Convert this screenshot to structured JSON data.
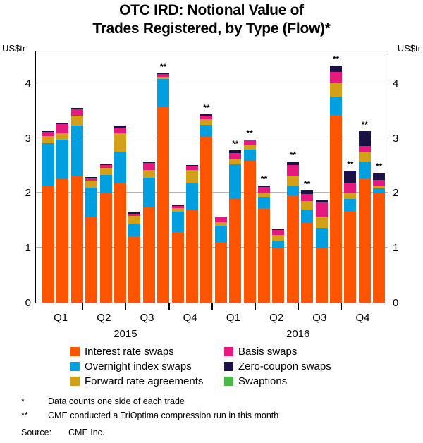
{
  "title_line1": "OTC IRD: Notional Value of",
  "title_line2": "Trades Registered, by Type (Flow)*",
  "unit_left": "US$tr",
  "unit_right": "US$tr",
  "legend": [
    {
      "label": "Interest rate swaps",
      "color": "#FF5400"
    },
    {
      "label": "Basis swaps",
      "color": "#E6197F"
    },
    {
      "label": "Overnight index swaps",
      "color": "#00A0E0"
    },
    {
      "label": "Zero-coupon swaps",
      "color": "#1B1147"
    },
    {
      "label": "Forward rate agreements",
      "color": "#D4A017"
    },
    {
      "label": "Swaptions",
      "color": "#4CB847"
    }
  ],
  "footnotes": {
    "mark1": "*",
    "text1": "Data counts one side of each trade",
    "mark2": "**",
    "text2": "CME conducted a TriOptima compression run in this month",
    "source_label": "Source:",
    "source_text": "CME Inc."
  },
  "quarters": [
    "Q1",
    "Q2",
    "Q3",
    "Q4",
    "Q1",
    "Q2",
    "Q3",
    "Q4"
  ],
  "years": [
    "2015",
    "2016"
  ],
  "chart_data": {
    "type": "bar",
    "stacked": true,
    "title": "OTC IRD: Notional Value of Trades Registered, by Type (Flow)",
    "xlabel": "",
    "ylabel": "US$tr",
    "ylim": [
      0,
      4.6
    ],
    "yticks": [
      0,
      1,
      2,
      3,
      4
    ],
    "ytick_labels": [
      "0",
      "1",
      "2",
      "3",
      "4"
    ],
    "grid": true,
    "legend_position": "below",
    "series_order": [
      "Interest rate swaps",
      "Overnight index swaps",
      "Forward rate agreements",
      "Basis swaps",
      "Zero-coupon swaps",
      "Swaptions"
    ],
    "series_colors": [
      "#FF5400",
      "#00A0E0",
      "#D4A017",
      "#E6197F",
      "#1B1147",
      "#4CB847"
    ],
    "x_group_labels": [
      "Q1 2015",
      "Q2 2015",
      "Q3 2015",
      "Q4 2015",
      "Q1 2016",
      "Q2 2016",
      "Q3 2016",
      "Q4 2016"
    ],
    "bars_per_group": 3,
    "bars": [
      {
        "group": "Q1 2015",
        "index": 1,
        "compression_run": false,
        "values": {
          "Interest rate swaps": 2.12,
          "Overnight index swaps": 0.78,
          "Forward rate agreements": 0.13,
          "Basis swaps": 0.08,
          "Zero-coupon swaps": 0.03,
          "Swaptions": 0.0
        },
        "total": 3.14
      },
      {
        "group": "Q1 2015",
        "index": 2,
        "compression_run": false,
        "values": {
          "Interest rate swaps": 2.25,
          "Overnight index swaps": 0.72,
          "Forward rate agreements": 0.12,
          "Basis swaps": 0.16,
          "Zero-coupon swaps": 0.03,
          "Swaptions": 0.0
        },
        "total": 3.28
      },
      {
        "group": "Q1 2015",
        "index": 3,
        "compression_run": false,
        "values": {
          "Interest rate swaps": 2.31,
          "Overnight index swaps": 0.92,
          "Forward rate agreements": 0.17,
          "Basis swaps": 0.12,
          "Zero-coupon swaps": 0.03,
          "Swaptions": 0.0
        },
        "total": 3.55
      },
      {
        "group": "Q2 2015",
        "index": 1,
        "compression_run": false,
        "values": {
          "Interest rate swaps": 1.57,
          "Overnight index swaps": 0.52,
          "Forward rate agreements": 0.13,
          "Basis swaps": 0.04,
          "Zero-coupon swaps": 0.03,
          "Swaptions": 0.0
        },
        "total": 2.29
      },
      {
        "group": "Q2 2015",
        "index": 2,
        "compression_run": false,
        "values": {
          "Interest rate swaps": 1.99,
          "Overnight index swaps": 0.34,
          "Forward rate agreements": 0.12,
          "Basis swaps": 0.05,
          "Zero-coupon swaps": 0.02,
          "Swaptions": 0.0
        },
        "total": 2.52
      },
      {
        "group": "Q2 2015",
        "index": 3,
        "compression_run": false,
        "values": {
          "Interest rate swaps": 2.19,
          "Overnight index swaps": 0.56,
          "Forward rate agreements": 0.34,
          "Basis swaps": 0.1,
          "Zero-coupon swaps": 0.04,
          "Swaptions": 0.0
        },
        "total": 3.23
      },
      {
        "group": "Q3 2015",
        "index": 1,
        "compression_run": false,
        "values": {
          "Interest rate swaps": 1.21,
          "Overnight index swaps": 0.22,
          "Forward rate agreements": 0.15,
          "Basis swaps": 0.04,
          "Zero-coupon swaps": 0.03,
          "Swaptions": 0.0
        },
        "total": 1.65
      },
      {
        "group": "Q3 2015",
        "index": 2,
        "compression_run": false,
        "values": {
          "Interest rate swaps": 1.73,
          "Overnight index swaps": 0.55,
          "Forward rate agreements": 0.14,
          "Basis swaps": 0.12,
          "Zero-coupon swaps": 0.02,
          "Swaptions": 0.0
        },
        "total": 2.56
      },
      {
        "group": "Q3 2015",
        "index": 3,
        "compression_run": true,
        "values": {
          "Interest rate swaps": 3.57,
          "Overnight index swaps": 0.5,
          "Forward rate agreements": 0.04,
          "Basis swaps": 0.05,
          "Zero-coupon swaps": 0.02,
          "Swaptions": 0.0
        },
        "total": 4.18
      },
      {
        "group": "Q4 2015",
        "index": 1,
        "compression_run": false,
        "values": {
          "Interest rate swaps": 1.28,
          "Overnight index swaps": 0.38,
          "Forward rate agreements": 0.06,
          "Basis swaps": 0.04,
          "Zero-coupon swaps": 0.02,
          "Swaptions": 0.0
        },
        "total": 1.78
      },
      {
        "group": "Q4 2015",
        "index": 2,
        "compression_run": false,
        "values": {
          "Interest rate swaps": 1.68,
          "Overnight index swaps": 0.5,
          "Forward rate agreements": 0.24,
          "Basis swaps": 0.07,
          "Zero-coupon swaps": 0.02,
          "Swaptions": 0.0
        },
        "total": 2.51
      },
      {
        "group": "Q4 2015",
        "index": 3,
        "compression_run": true,
        "values": {
          "Interest rate swaps": 3.02,
          "Overnight index swaps": 0.22,
          "Forward rate agreements": 0.1,
          "Basis swaps": 0.07,
          "Zero-coupon swaps": 0.02,
          "Swaptions": 0.0
        },
        "total": 3.43
      },
      {
        "group": "Q1 2016",
        "index": 1,
        "compression_run": false,
        "values": {
          "Interest rate swaps": 1.11,
          "Overnight index swaps": 0.29,
          "Forward rate agreements": 0.06,
          "Basis swaps": 0.09,
          "Zero-coupon swaps": 0.02,
          "Swaptions": 0.0
        },
        "total": 1.57
      },
      {
        "group": "Q1 2016",
        "index": 2,
        "compression_run": true,
        "values": {
          "Interest rate swaps": 1.89,
          "Overnight index swaps": 0.63,
          "Forward rate agreements": 0.09,
          "Basis swaps": 0.11,
          "Zero-coupon swaps": 0.05,
          "Swaptions": 0.0
        },
        "total": 2.77
      },
      {
        "group": "Q1 2016",
        "index": 3,
        "compression_run": true,
        "values": {
          "Interest rate swaps": 2.58,
          "Overnight index swaps": 0.21,
          "Forward rate agreements": 0.07,
          "Basis swaps": 0.09,
          "Zero-coupon swaps": 0.02,
          "Swaptions": 0.0
        },
        "total": 2.97
      },
      {
        "group": "Q2 2016",
        "index": 1,
        "compression_run": true,
        "values": {
          "Interest rate swaps": 1.72,
          "Overnight index swaps": 0.21,
          "Forward rate agreements": 0.08,
          "Basis swaps": 0.1,
          "Zero-coupon swaps": 0.02,
          "Swaptions": 0.0
        },
        "total": 2.13
      },
      {
        "group": "Q2 2016",
        "index": 2,
        "compression_run": false,
        "values": {
          "Interest rate swaps": 1.0,
          "Overnight index swaps": 0.13,
          "Forward rate agreements": 0.11,
          "Basis swaps": 0.08,
          "Zero-coupon swaps": 0.02,
          "Swaptions": 0.0
        },
        "total": 1.34
      },
      {
        "group": "Q2 2016",
        "index": 3,
        "compression_run": true,
        "values": {
          "Interest rate swaps": 1.95,
          "Overnight index swaps": 0.17,
          "Forward rate agreements": 0.19,
          "Basis swaps": 0.2,
          "Zero-coupon swaps": 0.06,
          "Swaptions": 0.0
        },
        "total": 2.57
      },
      {
        "group": "Q3 2016",
        "index": 1,
        "compression_run": true,
        "values": {
          "Interest rate swaps": 1.45,
          "Overnight index swaps": 0.24,
          "Forward rate agreements": 0.16,
          "Basis swaps": 0.13,
          "Zero-coupon swaps": 0.06,
          "Swaptions": 0.0
        },
        "total": 2.04
      },
      {
        "group": "Q3 2016",
        "index": 2,
        "compression_run": false,
        "values": {
          "Interest rate swaps": 0.99,
          "Overnight index swaps": 0.37,
          "Forward rate agreements": 0.19,
          "Basis swaps": 0.27,
          "Zero-coupon swaps": 0.06,
          "Swaptions": 0.0
        },
        "total": 1.88
      },
      {
        "group": "Q3 2016",
        "index": 3,
        "compression_run": true,
        "values": {
          "Interest rate swaps": 3.42,
          "Overnight index swaps": 0.33,
          "Forward rate agreements": 0.25,
          "Basis swaps": 0.2,
          "Zero-coupon swaps": 0.12,
          "Swaptions": 0.0
        },
        "total": 4.32
      },
      {
        "group": "Q4 2016",
        "index": 1,
        "compression_run": true,
        "values": {
          "Interest rate swaps": 1.67,
          "Overnight index swaps": 0.22,
          "Forward rate agreements": 0.12,
          "Basis swaps": 0.18,
          "Zero-coupon swaps": 0.21,
          "Swaptions": 0.0
        },
        "total": 2.4
      },
      {
        "group": "Q4 2016",
        "index": 2,
        "compression_run": true,
        "values": {
          "Interest rate swaps": 2.26,
          "Overnight index swaps": 0.31,
          "Forward rate agreements": 0.17,
          "Basis swaps": 0.11,
          "Zero-coupon swaps": 0.27,
          "Swaptions": 0.0
        },
        "total": 3.12
      },
      {
        "group": "Q4 2016",
        "index": 3,
        "compression_run": true,
        "values": {
          "Interest rate swaps": 1.99,
          "Overnight index swaps": 0.09,
          "Forward rate agreements": 0.04,
          "Basis swaps": 0.12,
          "Zero-coupon swaps": 0.13,
          "Swaptions": 0.0
        },
        "total": 2.37
      }
    ]
  }
}
